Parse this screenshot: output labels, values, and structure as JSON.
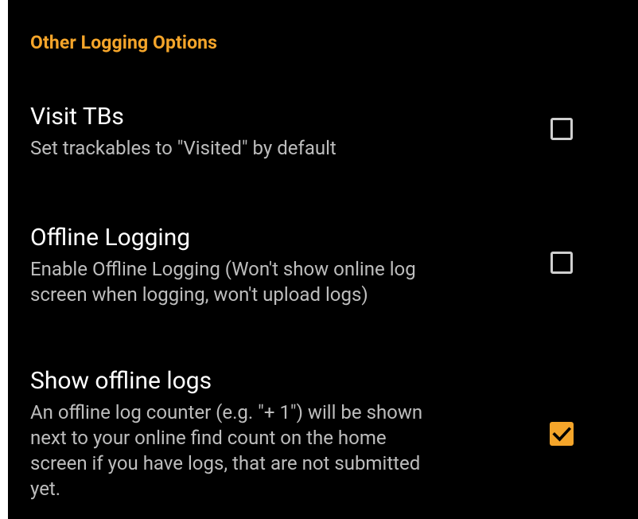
{
  "section": {
    "title": "Other Logging Options"
  },
  "preferences": [
    {
      "title": "Visit TBs",
      "summary": "Set trackables to \"Visited\" by default",
      "checked": false
    },
    {
      "title": "Offline Logging",
      "summary_lines": [
        "Enable Offline Logging (Won't show online log",
        "screen when logging, won't upload logs)"
      ],
      "checked": false
    },
    {
      "title": "Show offline logs",
      "summary_lines": [
        "An offline log counter (e.g. \"+ 1\") will be shown",
        "next to your online find count on the home",
        "screen if you have logs, that are not submitted",
        "yet."
      ],
      "checked": true
    }
  ],
  "colors": {
    "accent": "#f5a52a",
    "background": "#000000",
    "title_text": "#ffffff",
    "summary_text": "#bdbdbd"
  },
  "icons": {
    "checkmark": "check-icon"
  }
}
